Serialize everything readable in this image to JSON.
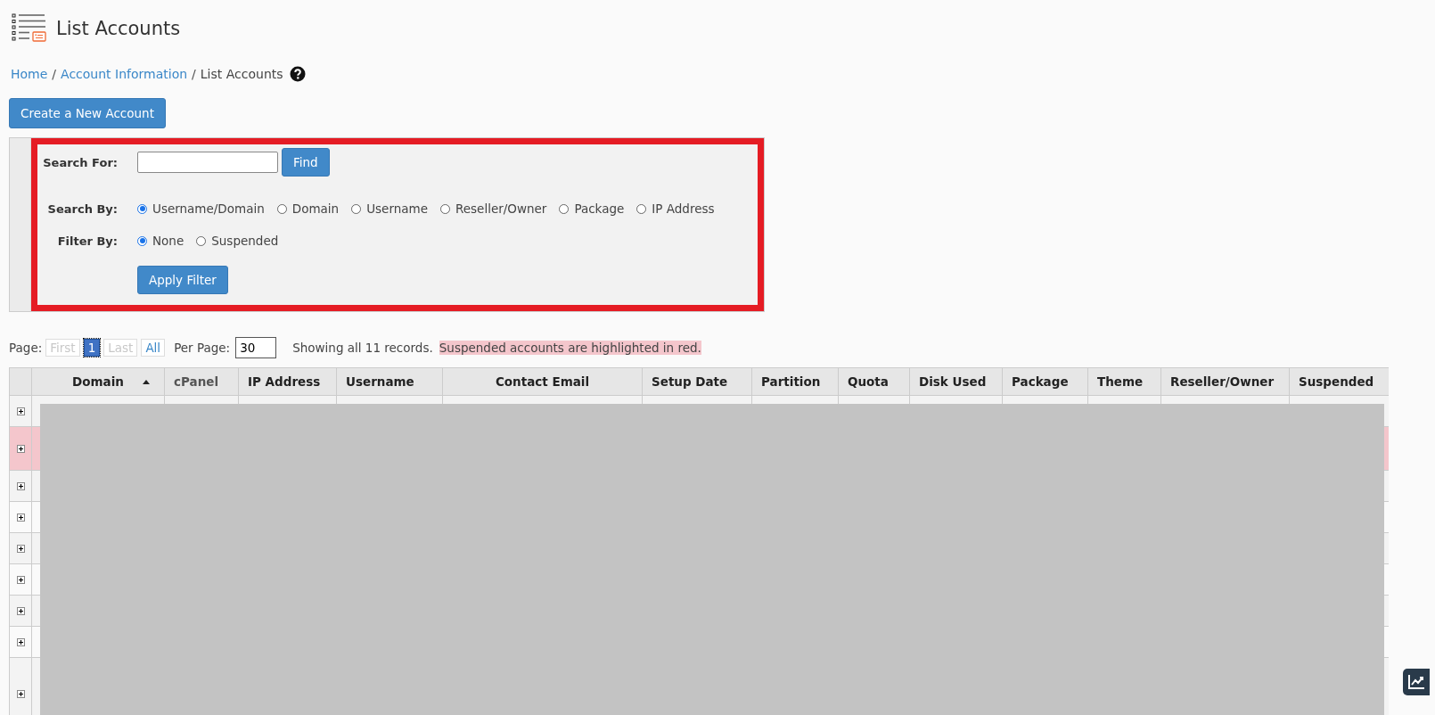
{
  "header": {
    "title": "List Accounts"
  },
  "breadcrumb": [
    {
      "label": "Home",
      "link": true,
      "separator": "/"
    },
    {
      "label": "Account Information",
      "link": true,
      "separator": "/"
    },
    {
      "label": "List Accounts",
      "link": false
    }
  ],
  "create_button": "Create a New Account",
  "filter": {
    "search_for": {
      "label": "Search For:",
      "button": "Find"
    },
    "search_by": {
      "label": "Search By:",
      "options": [
        {
          "label": "Username/Domain",
          "selected": true
        },
        {
          "label": "Domain",
          "selected": false
        },
        {
          "label": "Username",
          "selected": false
        },
        {
          "label": "Reseller/Owner",
          "selected": false
        },
        {
          "label": "Package",
          "selected": false
        },
        {
          "label": "IP Address",
          "selected": false
        }
      ]
    },
    "filter_by": {
      "label": "Filter By:",
      "options": [
        {
          "label": "None",
          "selected": true
        },
        {
          "label": "Suspended",
          "selected": false
        }
      ]
    },
    "apply_button": "Apply Filter"
  },
  "pagination": {
    "label": "Page:",
    "pages": [
      {
        "label": "First",
        "selected": false,
        "disabled": true
      },
      {
        "label": "1",
        "selected": true,
        "disabled": false
      },
      {
        "label": "Last",
        "selected": false,
        "disabled": true
      },
      {
        "label": "All",
        "selected": false,
        "disabled": false
      }
    ],
    "per_page": {
      "label": "Per Page:",
      "value": "30"
    },
    "summary": "Showing all 11 records.",
    "notice": "Suspended accounts are highlighted in red."
  },
  "table": {
    "columns": [
      {
        "label": "Domain",
        "sorted": true
      },
      {
        "label": "cPanel",
        "sorted": false
      },
      {
        "label": "IP Address",
        "sorted": false
      },
      {
        "label": "Username",
        "sorted": false
      },
      {
        "label": "Contact Email",
        "sorted": false
      },
      {
        "label": "Setup Date",
        "sorted": false
      },
      {
        "label": "Partition",
        "sorted": false
      },
      {
        "label": "Quota",
        "sorted": false
      },
      {
        "label": "Disk Used",
        "sorted": false
      },
      {
        "label": "Package",
        "sorted": false
      },
      {
        "label": "Theme",
        "sorted": false
      },
      {
        "label": "Reseller/Owner",
        "sorted": false
      },
      {
        "label": "Suspended",
        "sorted": false
      }
    ],
    "rows": [
      {
        "suspended": false
      },
      {
        "suspended": true
      },
      {
        "suspended": false
      },
      {
        "suspended": false
      },
      {
        "suspended": false
      },
      {
        "suspended": false
      },
      {
        "suspended": false
      },
      {
        "suspended": false
      },
      {
        "suspended": false
      }
    ]
  }
}
